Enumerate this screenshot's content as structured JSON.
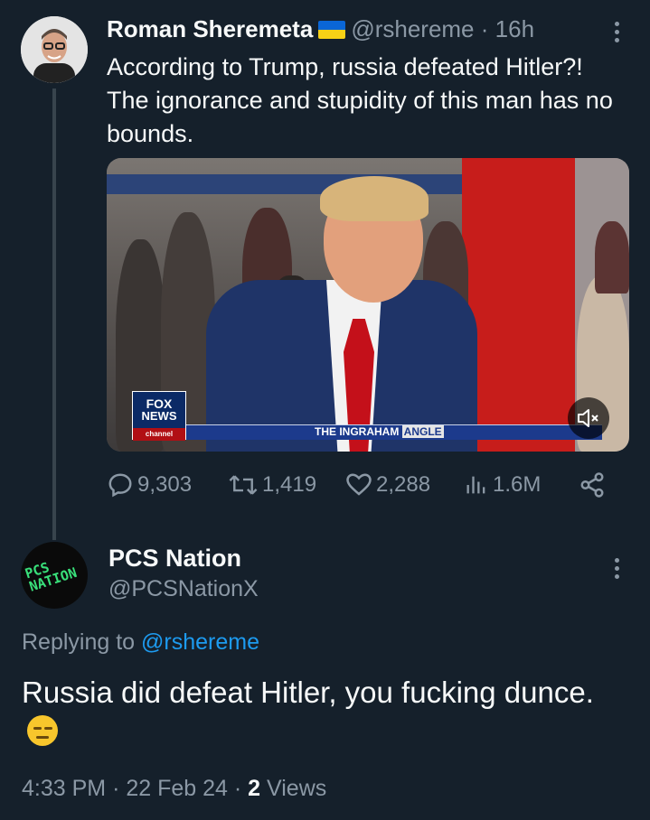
{
  "tweet1": {
    "name": "Roman Sheremeta",
    "handle": "@rshereme",
    "separator": "·",
    "time": "16h",
    "text": "According to Trump, russia defeated Hitler?! The ignorance and stupidity of this man has no bounds.",
    "media": {
      "logo_line1": "FOX",
      "logo_line2": "NEWS",
      "logo_line3": "channel",
      "show_title": "THE INGRAHAM",
      "show_title_tag": "ANGLE",
      "mute_icon": "speaker-muted-icon"
    },
    "stats": {
      "replies": "9,303",
      "reposts": "1,419",
      "likes": "2,288",
      "views": "1.6M"
    }
  },
  "tweet2": {
    "name": "PCS Nation",
    "handle": "@PCSNationX",
    "avatar_text": "PCS NATION",
    "replying_prefix": "Replying to",
    "replying_handle": "@rshereme",
    "text": "Russia did defeat Hitler, you fucking dunce.",
    "emoji": "expressionless-face",
    "time": "4:33 PM",
    "date": "22 Feb 24",
    "separator": "·",
    "views_count": "2",
    "views_label": "Views"
  },
  "colors": {
    "background": "#15202b",
    "text": "#f7f9f9",
    "muted": "#8b98a5",
    "link": "#1d9bf0"
  }
}
